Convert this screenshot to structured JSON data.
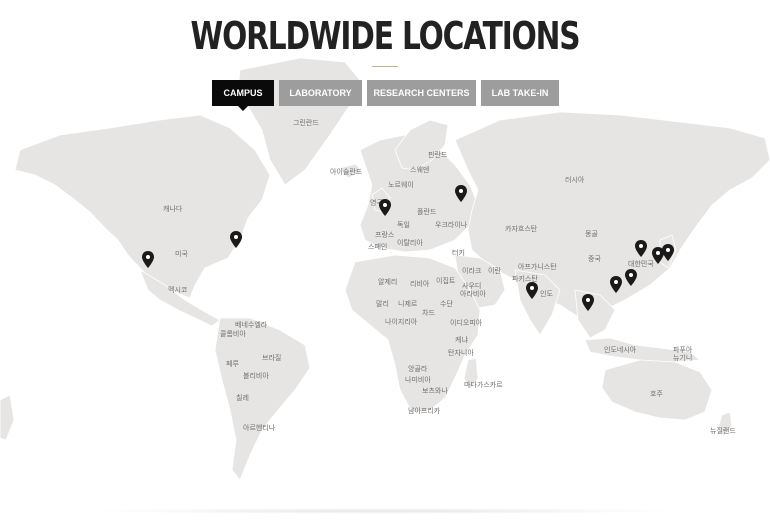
{
  "page_title": "WORLDWIDE LOCATIONS",
  "tabs": [
    {
      "label": "CAMPUS",
      "active": true
    },
    {
      "label": "LABORATORY",
      "active": false
    },
    {
      "label": "RESEARCH CENTERS",
      "active": false
    },
    {
      "label": "LAB TAKE-IN",
      "active": false
    }
  ],
  "colors": {
    "accent": "#0a0a0a",
    "tab_inactive": "#9d9d9d",
    "land": "#e6e5e3",
    "marker": "#1a1a1a"
  },
  "map_labels": {
    "greenland": "그린란드",
    "iceland": "아이슬란드",
    "finland": "핀란드",
    "sweden": "스웨덴",
    "norway": "노르웨이",
    "russia": "러시아",
    "canada": "캐나다",
    "uk": "영국",
    "poland": "폴란드",
    "germany": "독일",
    "france": "프랑스",
    "ukraine": "우크라이나",
    "spain": "스페인",
    "italy": "이탈리아",
    "kazakhstan": "카자흐스탄",
    "mongolia": "몽골",
    "turkey": "터키",
    "usa": "미국",
    "china": "중국",
    "korea": "대한민국",
    "japan": "일본",
    "afghanistan": "아프가니스탄",
    "iraq": "이라크",
    "iran": "이란",
    "pakistan": "파키스탄",
    "algeria": "알제리",
    "libya": "리비아",
    "egypt": "이집트",
    "saudi": "사우디\n아라비아",
    "mexico": "멕시코",
    "india": "인도",
    "mali": "말리",
    "niger": "니제르",
    "chad": "차드",
    "sudan": "수단",
    "nigeria": "나이지리아",
    "ethiopia": "이디오피아",
    "venezuela": "베네수엘라",
    "colombia": "콜롬비아",
    "kenya": "케냐",
    "tanzania": "탄자니아",
    "indonesia": "인도네시아",
    "papua": "파푸아\n뉴기니",
    "peru": "페루",
    "brazil": "브라질",
    "bolivia": "볼리비아",
    "angola": "앙골라",
    "namibia": "나미비아",
    "botswana": "보츠와나",
    "madagascar": "마다가스카르",
    "chile": "칠레",
    "australia": "호주",
    "south_africa": "남아프리카",
    "argentina": "아르헨티나",
    "new_zealand": "뉴질랜드"
  },
  "markers_count": 11
}
